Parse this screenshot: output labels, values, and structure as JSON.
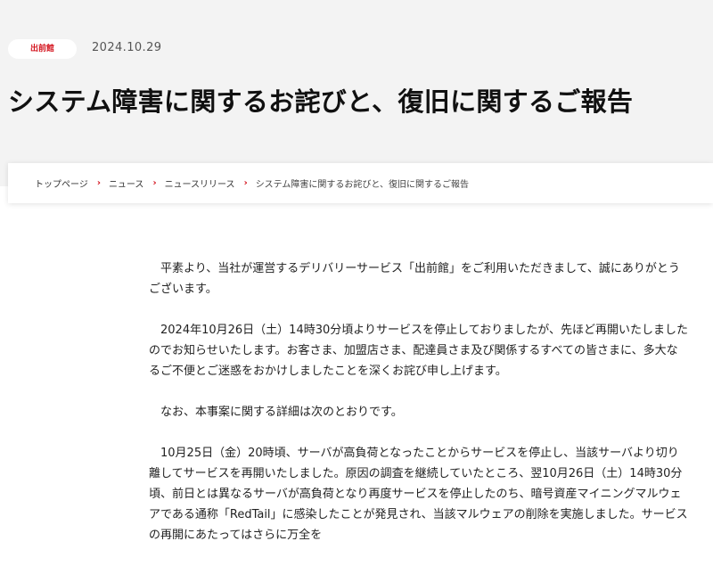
{
  "header": {
    "tag": "出前館",
    "date": "2024.10.29",
    "title": "システム障害に関するお詫びと、復旧に関するご報告"
  },
  "breadcrumb": {
    "items": [
      "トップページ",
      "ニュース",
      "ニュースリリース"
    ],
    "current": "システム障害に関するお詫びと、復旧に関するご報告",
    "separator": "›"
  },
  "body": {
    "paragraphs": [
      "平素より、当社が運営するデリバリーサービス「出前館」をご利用いただきまして、誠にありがとうございます。",
      "2024年10月26日（土）14時30分頃よりサービスを停止しておりましたが、先ほど再開いたしましたのでお知らせいたします。お客さま、加盟店さま、配達員さま及び関係するすべての皆さまに、多大なるご不便とご迷惑をおかけしましたことを深くお詫び申し上げます。",
      "なお、本事案に関する詳細は次のとおりです。",
      "10月25日（金）20時頃、サーバが高負荷となったことからサービスを停止し、当該サーバより切り離してサービスを再開いたしました。原因の調査を継続していたところ、翌10月26日（土）14時30分頃、前日とは異なるサーバが高負荷となり再度サービスを停止したのち、暗号資産マイニングマルウェアである通称「RedTail」に感染したことが発見され、当該マルウェアの削除を実施しました。サービスの再開にあたってはさらに万全を"
    ]
  },
  "colors": {
    "accent": "#d4141e",
    "hero_bg": "#f3f3f3"
  }
}
